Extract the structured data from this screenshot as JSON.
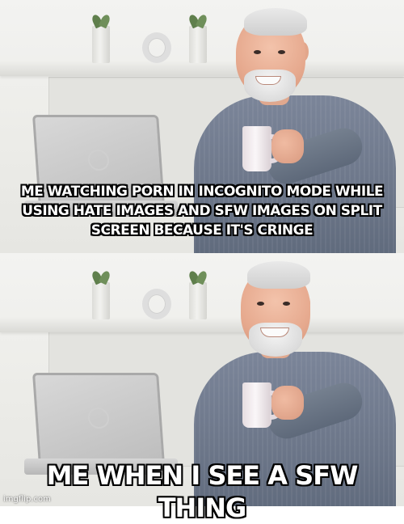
{
  "meme": {
    "template": "Hide the Pain Harold",
    "top_caption": "ME WATCHING PORN IN INCOGNITO MODE WHILE USING HATE IMAGES AND SFW IMAGES ON SPLIT SCREEN BECAUSE IT'S CRINGE",
    "bottom_caption": "ME WHEN I SEE A SFW THING",
    "watermark": "imgflip.com"
  }
}
